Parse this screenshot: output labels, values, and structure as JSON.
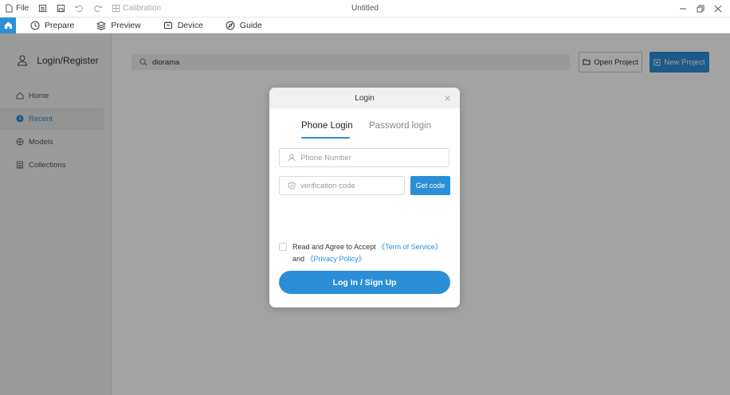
{
  "titlebar": {
    "file_label": "File",
    "calibration_label": "Calibration",
    "window_title": "Untitled"
  },
  "tabs": [
    {
      "label": "Prepare",
      "icon": "prepare-icon"
    },
    {
      "label": "Preview",
      "icon": "preview-icon"
    },
    {
      "label": "Device",
      "icon": "device-icon"
    },
    {
      "label": "Guide",
      "icon": "guide-icon"
    }
  ],
  "sidebar": {
    "user_label": "Login/Register",
    "items": [
      {
        "label": "Home",
        "icon": "home-icon",
        "active": false
      },
      {
        "label": "Recent",
        "icon": "recent-icon",
        "active": true
      },
      {
        "label": "Models",
        "icon": "models-icon",
        "active": false
      },
      {
        "label": "Collections",
        "icon": "collections-icon",
        "active": false
      }
    ]
  },
  "main": {
    "search_value": "diorama",
    "open_project_label": "Open Project",
    "new_project_label": "New Project"
  },
  "dialog": {
    "title": "Login",
    "tab_phone": "Phone Login",
    "tab_password": "Password login",
    "phone_placeholder": "Phone Number",
    "code_placeholder": "verification code",
    "get_code_label": "Get code",
    "agree_prefix": "Read and Agree to Accept ",
    "terms_link": "《Term of Service》",
    "agree_and": " and ",
    "privacy_link": "《Privacy Policy》",
    "login_button": "Log In / Sign Up"
  },
  "colors": {
    "accent": "#2a8fd6",
    "overlay": "rgba(0,0,0,0.36)"
  }
}
